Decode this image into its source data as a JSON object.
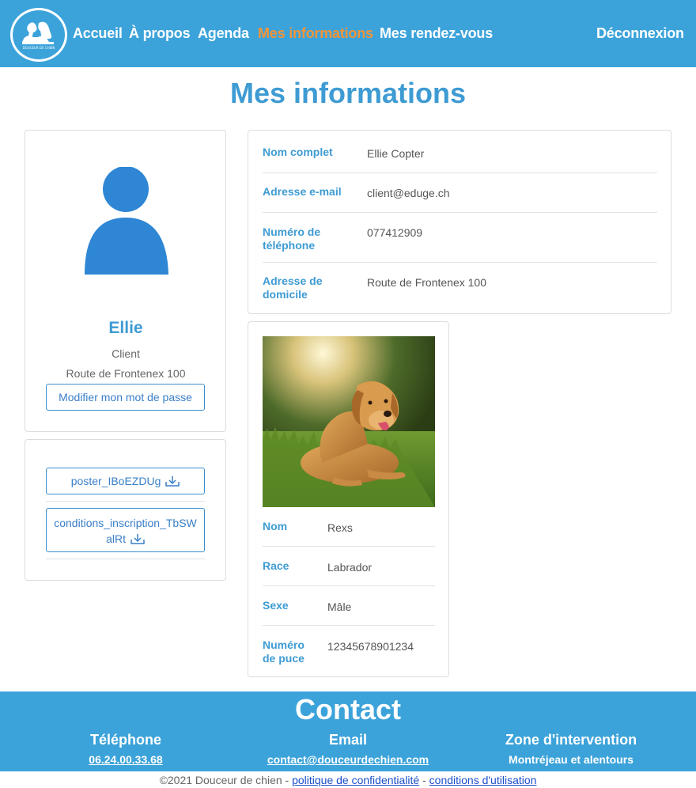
{
  "nav": {
    "items": [
      {
        "label": "Accueil"
      },
      {
        "label": "À propos"
      },
      {
        "label": "Agenda"
      },
      {
        "label": "Mes informations"
      },
      {
        "label": "Mes rendez-vous"
      }
    ],
    "logout": "Déconnexion",
    "logo_text": "DOUCEUR DE CHIEN",
    "active_color": "#f0953a",
    "bar_color": "#3ca3da"
  },
  "page_title": "Mes informations",
  "profile": {
    "name": "Ellie",
    "role": "Client",
    "address": "Route de Frontenex 100",
    "change_password": "Modifier mon mot de passe",
    "avatar_icon": "user-icon"
  },
  "documents": [
    {
      "label": "poster_IBoEZDUg",
      "icon": "download-icon"
    },
    {
      "label_line1": "conditions_inscription_TbSW",
      "label_line2": "alRt",
      "icon": "download-icon"
    }
  ],
  "info": {
    "rows": [
      {
        "label": "Nom complet",
        "value": "Ellie Copter"
      },
      {
        "label": "Adresse e-mail",
        "value": "client@eduge.ch"
      },
      {
        "label_line1": "Numéro de",
        "label_line2": "téléphone",
        "value": "077412909"
      },
      {
        "label_line1": "Adresse de",
        "label_line2": "domicile",
        "value": "Route de Frontenex 100"
      }
    ]
  },
  "dog": {
    "rows": [
      {
        "label": "Nom",
        "value": "Rexs"
      },
      {
        "label": "Race",
        "value": "Labrador"
      },
      {
        "label": "Sexe",
        "value": "Mâle"
      },
      {
        "label_line1": "Numéro",
        "label_line2": "de puce",
        "value": "12345678901234"
      }
    ]
  },
  "footer": {
    "title": "Contact",
    "phone_head": "Téléphone",
    "phone": "06.24.00.33.68",
    "email_head": "Email",
    "email": "contact@douceurdechien.com",
    "zone_head": "Zone d'intervention",
    "zone": "Montréjeau et alentours"
  },
  "copyright": {
    "text": "©2021 Douceur de chien - ",
    "privacy": "politique de confidentialité",
    "sep": " - ",
    "terms": "conditions d'utilisation"
  }
}
